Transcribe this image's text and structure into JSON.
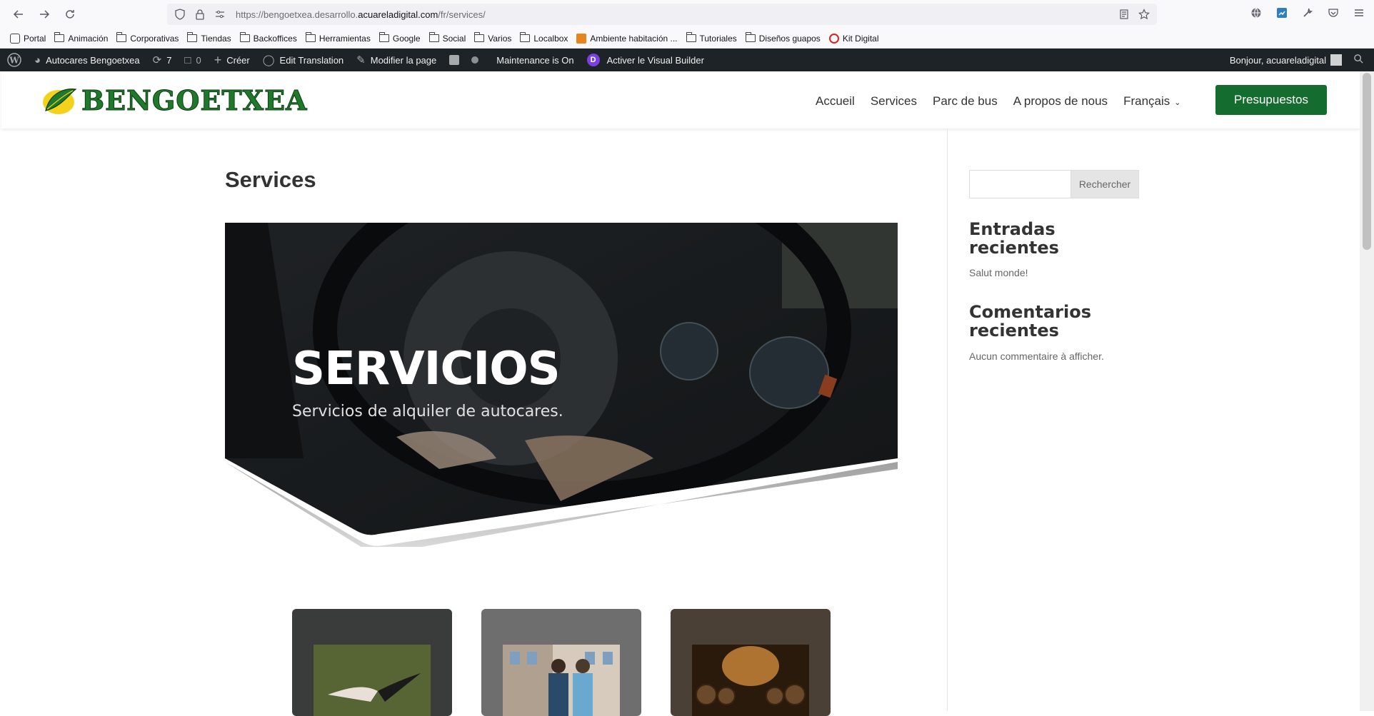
{
  "browser": {
    "url_prefix": "https://bengoetxea.desarrollo.",
    "url_domain": "acuareladigital.com",
    "url_path": "/fr/services/"
  },
  "bookmarks": [
    {
      "label": "Portal",
      "type": "favicon"
    },
    {
      "label": "Animación",
      "type": "folder"
    },
    {
      "label": "Corporativas",
      "type": "folder"
    },
    {
      "label": "Tiendas",
      "type": "folder"
    },
    {
      "label": "Backoffices",
      "type": "folder"
    },
    {
      "label": "Herramientas",
      "type": "folder"
    },
    {
      "label": "Google",
      "type": "folder"
    },
    {
      "label": "Social",
      "type": "folder"
    },
    {
      "label": "Varios",
      "type": "folder"
    },
    {
      "label": "Localbox",
      "type": "folder"
    },
    {
      "label": "Ambiente habitación ...",
      "type": "favicon"
    },
    {
      "label": "Tutoriales",
      "type": "folder"
    },
    {
      "label": "Diseños guapos",
      "type": "folder"
    },
    {
      "label": "Kit Digital",
      "type": "favicon"
    }
  ],
  "adminbar": {
    "site_name": "Autocares Bengoetxea",
    "updates": "7",
    "comments": "0",
    "create": "Créer",
    "edit_translation": "Edit Translation",
    "modify_page": "Modifier la page",
    "maintenance": "Maintenance is On",
    "visual_builder": "Activer le Visual Builder",
    "greeting": "Bonjour, acuareladigital"
  },
  "header": {
    "logo_text": "BENGOETXEA",
    "nav": [
      "Accueil",
      "Services",
      "Parc de bus",
      "A propos de nous",
      "Français"
    ],
    "cta": "Presupuestos"
  },
  "main": {
    "page_title": "Services",
    "hero_title": "SERVICIOS",
    "hero_subtitle": "Servicios de alquiler de autocares."
  },
  "sidebar": {
    "search_button": "Rechercher",
    "recent_posts_title": "Entradas recientes",
    "recent_post_1": "Salut monde!",
    "recent_comments_title": "Comentarios recientes",
    "no_comments": "Aucun commentaire à afficher."
  },
  "colors": {
    "brand_green": "#146c2e",
    "adminbar_bg": "#1d2327"
  }
}
